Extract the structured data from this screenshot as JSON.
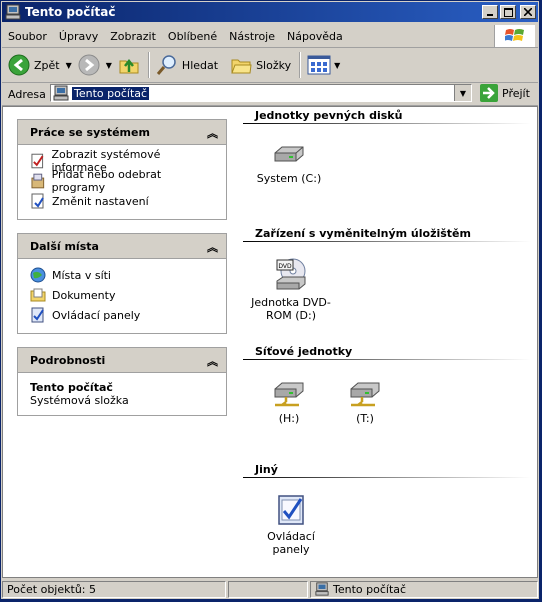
{
  "window": {
    "title": "Tento počítač"
  },
  "menu": {
    "items": [
      "Soubor",
      "Úpravy",
      "Zobrazit",
      "Oblíbené",
      "Nástroje",
      "Nápověda"
    ]
  },
  "toolbar": {
    "back_label": "Zpět",
    "search_label": "Hledat",
    "folders_label": "Složky"
  },
  "address": {
    "label": "Adresa",
    "value": "Tento počítač",
    "go_label": "Přejít"
  },
  "tasks": {
    "system": {
      "title": "Práce se systémem",
      "items": [
        "Zobrazit systémové informace",
        "Přidat nebo odebrat programy",
        "Změnit nastavení"
      ]
    },
    "places": {
      "title": "Další místa",
      "items": [
        "Místa v síti",
        "Dokumenty",
        "Ovládací panely"
      ]
    },
    "details": {
      "title": "Podrobnosti",
      "name": "Tento počítač",
      "type": "Systémová složka"
    }
  },
  "groups": {
    "hard_drives": {
      "title": "Jednotky pevných disků",
      "items": [
        "System (C:)"
      ]
    },
    "removable": {
      "title": "Zařízení s vyměnitelným úložištěm",
      "items": [
        "Jednotka DVD-ROM (D:)"
      ]
    },
    "network": {
      "title": "Síťové jednotky",
      "items": [
        "(H:)",
        "(T:)"
      ]
    },
    "other": {
      "title": "Jiný",
      "items": [
        "Ovládací panely"
      ]
    }
  },
  "status": {
    "count": "Počet objektů: 5",
    "location": "Tento počítač"
  },
  "colors": {
    "titlebar": "#0a246a",
    "selection": "#0a246a",
    "chrome": "#d4d0c8"
  }
}
